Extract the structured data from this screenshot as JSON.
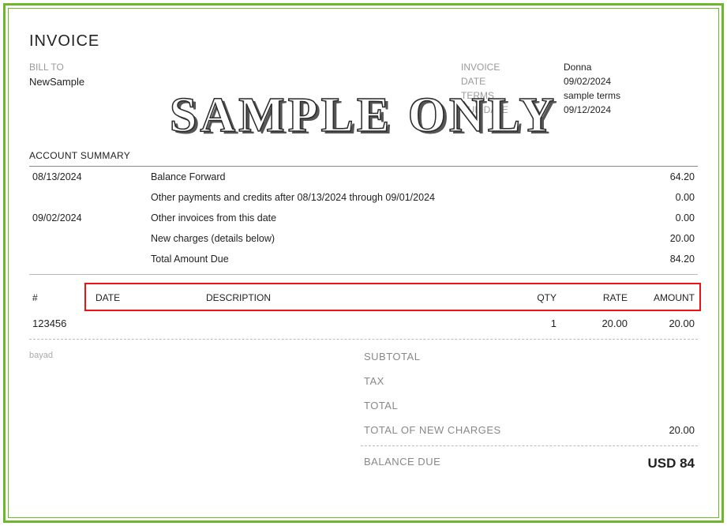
{
  "watermark": "SAMPLE ONLY",
  "title": "INVOICE",
  "bill_to": {
    "label": "BILL TO",
    "name": "NewSample"
  },
  "info": {
    "invoice_label": "INVOICE",
    "invoice_value": "Donna",
    "date_label": "DATE",
    "date_value": "09/02/2024",
    "terms_label": "TERMS",
    "terms_value": "sample terms",
    "due_label": "DUE DATE",
    "due_value": "09/12/2024"
  },
  "summary": {
    "heading": "ACCOUNT SUMMARY",
    "rows": [
      {
        "date": "08/13/2024",
        "desc": "Balance Forward",
        "amount": "64.20"
      },
      {
        "date": "",
        "desc": "Other payments and credits after 08/13/2024 through 09/01/2024",
        "amount": "0.00"
      },
      {
        "date": "09/02/2024",
        "desc": "Other invoices from this date",
        "amount": "0.00"
      },
      {
        "date": "",
        "desc": "New charges (details below)",
        "amount": "20.00"
      },
      {
        "date": "",
        "desc": "Total Amount Due",
        "amount": "84.20"
      }
    ]
  },
  "lines": {
    "headers": {
      "num": "#",
      "date": "DATE",
      "desc": "DESCRIPTION",
      "qty": "QTY",
      "rate": "RATE",
      "amount": "AMOUNT"
    },
    "rows": [
      {
        "num": "123456",
        "date": "",
        "desc": "",
        "qty": "1",
        "rate": "20.00",
        "amount": "20.00"
      }
    ]
  },
  "footer_note": "bayad",
  "totals": {
    "subtotal_label": "SUBTOTAL",
    "subtotal_value": "",
    "tax_label": "TAX",
    "tax_value": "",
    "total_label": "TOTAL",
    "total_value": "",
    "new_charges_label": "TOTAL OF NEW CHARGES",
    "new_charges_value": "20.00",
    "balance_due_label": "BALANCE DUE",
    "balance_due_value": "USD 84"
  }
}
